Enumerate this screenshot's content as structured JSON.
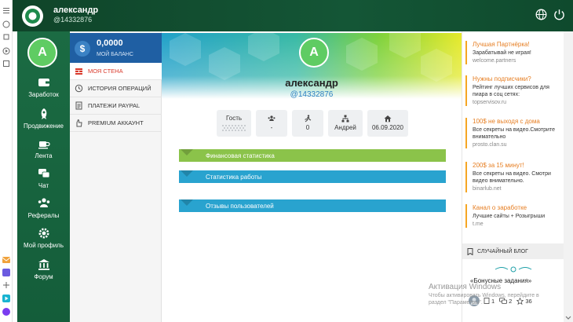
{
  "header": {
    "user_name": "александр",
    "user_handle": "@14332876",
    "icons": [
      "globe-icon",
      "power-icon"
    ]
  },
  "nav": {
    "avatar_letter": "A",
    "items": [
      {
        "label": "Заработок",
        "icon": "wallet-icon"
      },
      {
        "label": "Продвижение",
        "icon": "rocket-icon"
      },
      {
        "label": "Лента",
        "icon": "coffee-icon"
      },
      {
        "label": "Чат",
        "icon": "chat-icon"
      },
      {
        "label": "Рефералы",
        "icon": "users-icon"
      },
      {
        "label": "Мой профиль",
        "icon": "gear-icon"
      },
      {
        "label": "Форум",
        "icon": "bank-icon"
      }
    ]
  },
  "balance": {
    "value": "0,0000",
    "label": "МОЙ БАЛАНС",
    "coin_symbol": "$"
  },
  "menu": [
    {
      "label": "МОЯ СТЕНА",
      "icon": "wall-icon",
      "active": true
    },
    {
      "label": "ИСТОРИЯ ОПЕРАЦИЙ",
      "icon": "history-icon",
      "active": false
    },
    {
      "label": "ПЛАТЕЖИ PAYPAL",
      "icon": "document-icon",
      "active": false
    },
    {
      "label": "PREMIUM АККАУНТ",
      "icon": "hand-icon",
      "active": false
    }
  ],
  "profile": {
    "avatar_letter": "A",
    "name": "александр",
    "handle": "@14332876",
    "stats": [
      {
        "value": "Гость",
        "icon": "status-icon"
      },
      {
        "value": "-",
        "icon": "group-icon"
      },
      {
        "value": "0",
        "icon": "runner-icon"
      },
      {
        "value": "Андрей",
        "icon": "sitemap-icon"
      },
      {
        "value": "06.09.2020",
        "icon": "home-icon"
      }
    ]
  },
  "sections": [
    {
      "label": "Финансовая статистика",
      "color": "#8bc34a"
    },
    {
      "label": "Статистика работы",
      "color": "#29a3cf"
    },
    {
      "label": "Отзывы пользователей",
      "color": "#29a3cf"
    }
  ],
  "ads": [
    {
      "title": "Лучшая Партнёрка!",
      "desc": "Зарабатывай не играя!",
      "url": "welcome.partners"
    },
    {
      "title": "Нужны подписчики?",
      "desc": "Рейтинг лучших сервисов для пиара в соц сетях:",
      "url": "topservisov.ru"
    },
    {
      "title": "100$ не выходя с дома",
      "desc": "Все секреты на видео.Смотрите внимательно",
      "url": "prosto.clan.su"
    },
    {
      "title": "200$ за 15 минут!",
      "desc": "Все секреты на видео. Смотри видео внимательно.",
      "url": "binarlub.net"
    },
    {
      "title": "Канал о заработке",
      "desc": "Лучшие сайты + Розыгрыши",
      "url": "t.me"
    }
  ],
  "blog": {
    "header": "СЛУЧАЙНЫЙ БЛОГ",
    "title": "«Бонусные задания»",
    "count_a": "1",
    "count_b": "2",
    "count_c": "36"
  },
  "watermark": {
    "line1": "Активация Windows",
    "line2": "Чтобы активировать Windows, перейдите в раздел \"Параметры\"."
  },
  "colors": {
    "topbar": "#145636",
    "nav": "#1b6b43",
    "balance": "#1f5fa3",
    "accent_red": "#d9392b",
    "ad_title": "#e67e22",
    "section_green": "#8bc34a",
    "section_blue": "#29a3cf"
  }
}
